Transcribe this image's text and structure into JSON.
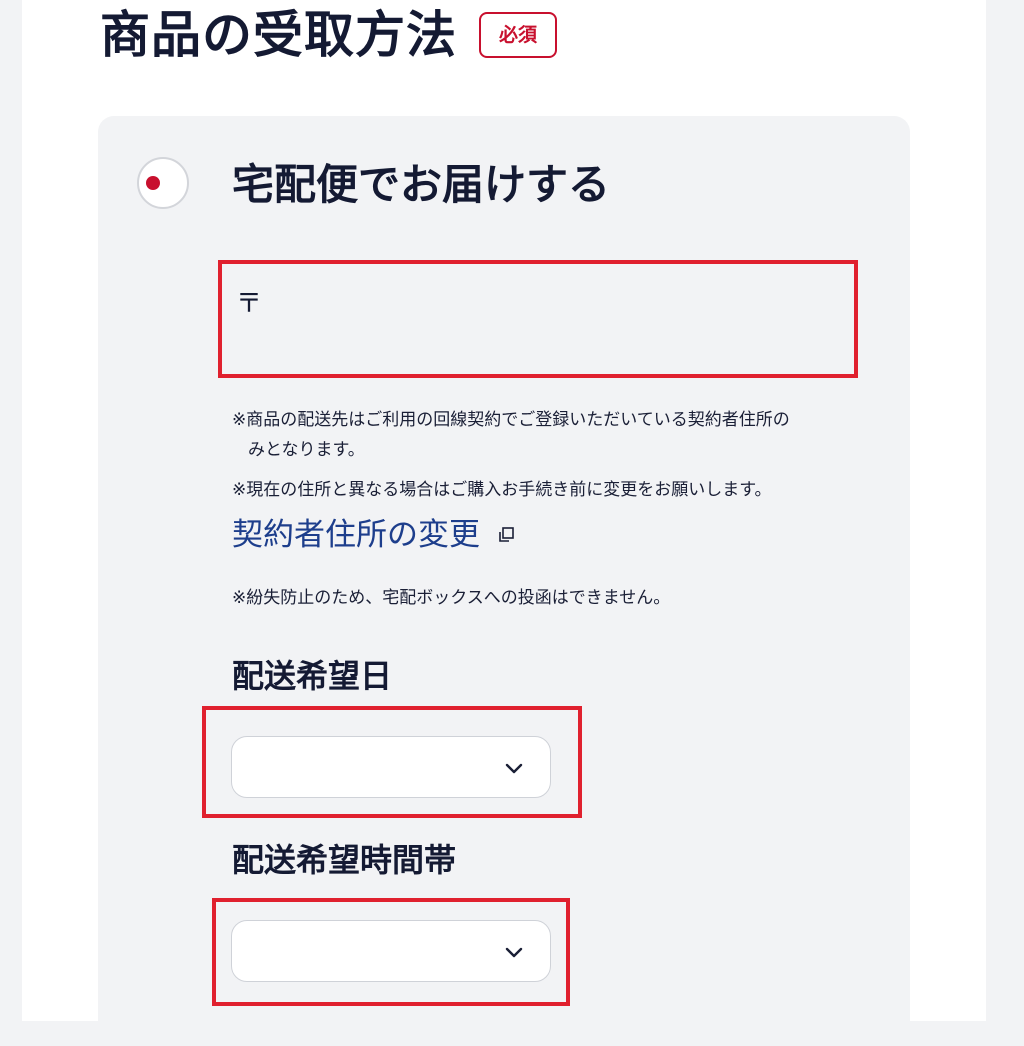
{
  "section": {
    "title": "商品の受取方法",
    "required_badge": "必須"
  },
  "delivery_option": {
    "label": "宅配便でお届けする",
    "selected": true,
    "postal_mark": "〒",
    "notes": [
      "※商品の配送先はご利用の回線契約でご登録いただいている契約者住所の",
      "みとなります。",
      "※現在の住所と異なる場合はご購入お手続き前に変更をお願いします。",
      "※紛失防止のため、宅配ボックスへの投函はできません。"
    ],
    "change_address_link": "契約者住所の変更"
  },
  "delivery_date": {
    "label": "配送希望日",
    "value": ""
  },
  "delivery_time": {
    "label": "配送希望時間帯",
    "value": ""
  },
  "colors": {
    "accent_red": "#c8102e",
    "highlight_red": "#e0202e",
    "link_blue": "#1d3e8c",
    "text_dark": "#141a33"
  },
  "icons": {
    "radio": "radio-selected-icon",
    "external": "external-window-icon",
    "chevron": "chevron-down-icon"
  }
}
